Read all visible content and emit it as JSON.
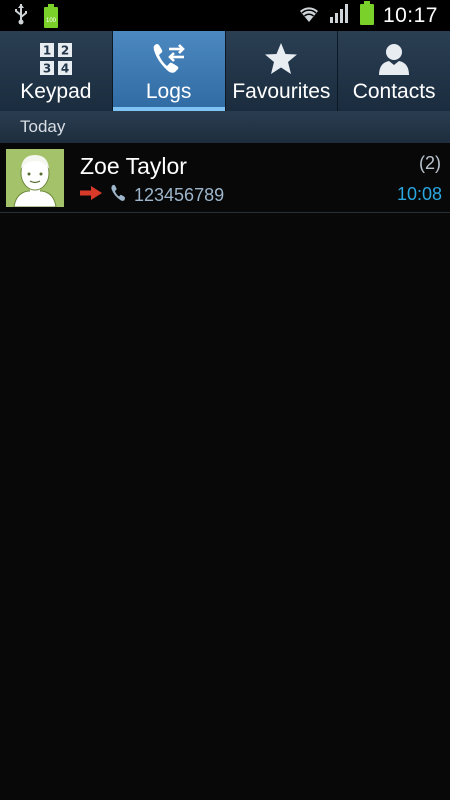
{
  "status_bar": {
    "battery_percent_label": "100",
    "time": "10:17",
    "icons": [
      "usb-icon",
      "battery-full-icon",
      "wifi-icon",
      "signal-icon",
      "battery-icon"
    ]
  },
  "tabs": [
    {
      "label": "Keypad",
      "icon": "keypad-icon",
      "active": false
    },
    {
      "label": "Logs",
      "icon": "call-log-icon",
      "active": true
    },
    {
      "label": "Favourites",
      "icon": "star-icon",
      "active": false
    },
    {
      "label": "Contacts",
      "icon": "contact-icon",
      "active": false
    }
  ],
  "keypad_digits": [
    "1",
    "2",
    "3",
    "4"
  ],
  "section": {
    "title": "Today"
  },
  "logs": [
    {
      "name": "Zoe Taylor",
      "count": "(2)",
      "number": "123456789",
      "time": "10:08",
      "direction": "outgoing",
      "colors": {
        "direction_arrow": "#d83a2a",
        "time": "#2aa6e0"
      }
    }
  ],
  "colors": {
    "active_tab": "#4d89c1",
    "active_tab_indicator": "#7fc3f5",
    "background": "#080808",
    "avatar_bg": "#a4c26a"
  }
}
